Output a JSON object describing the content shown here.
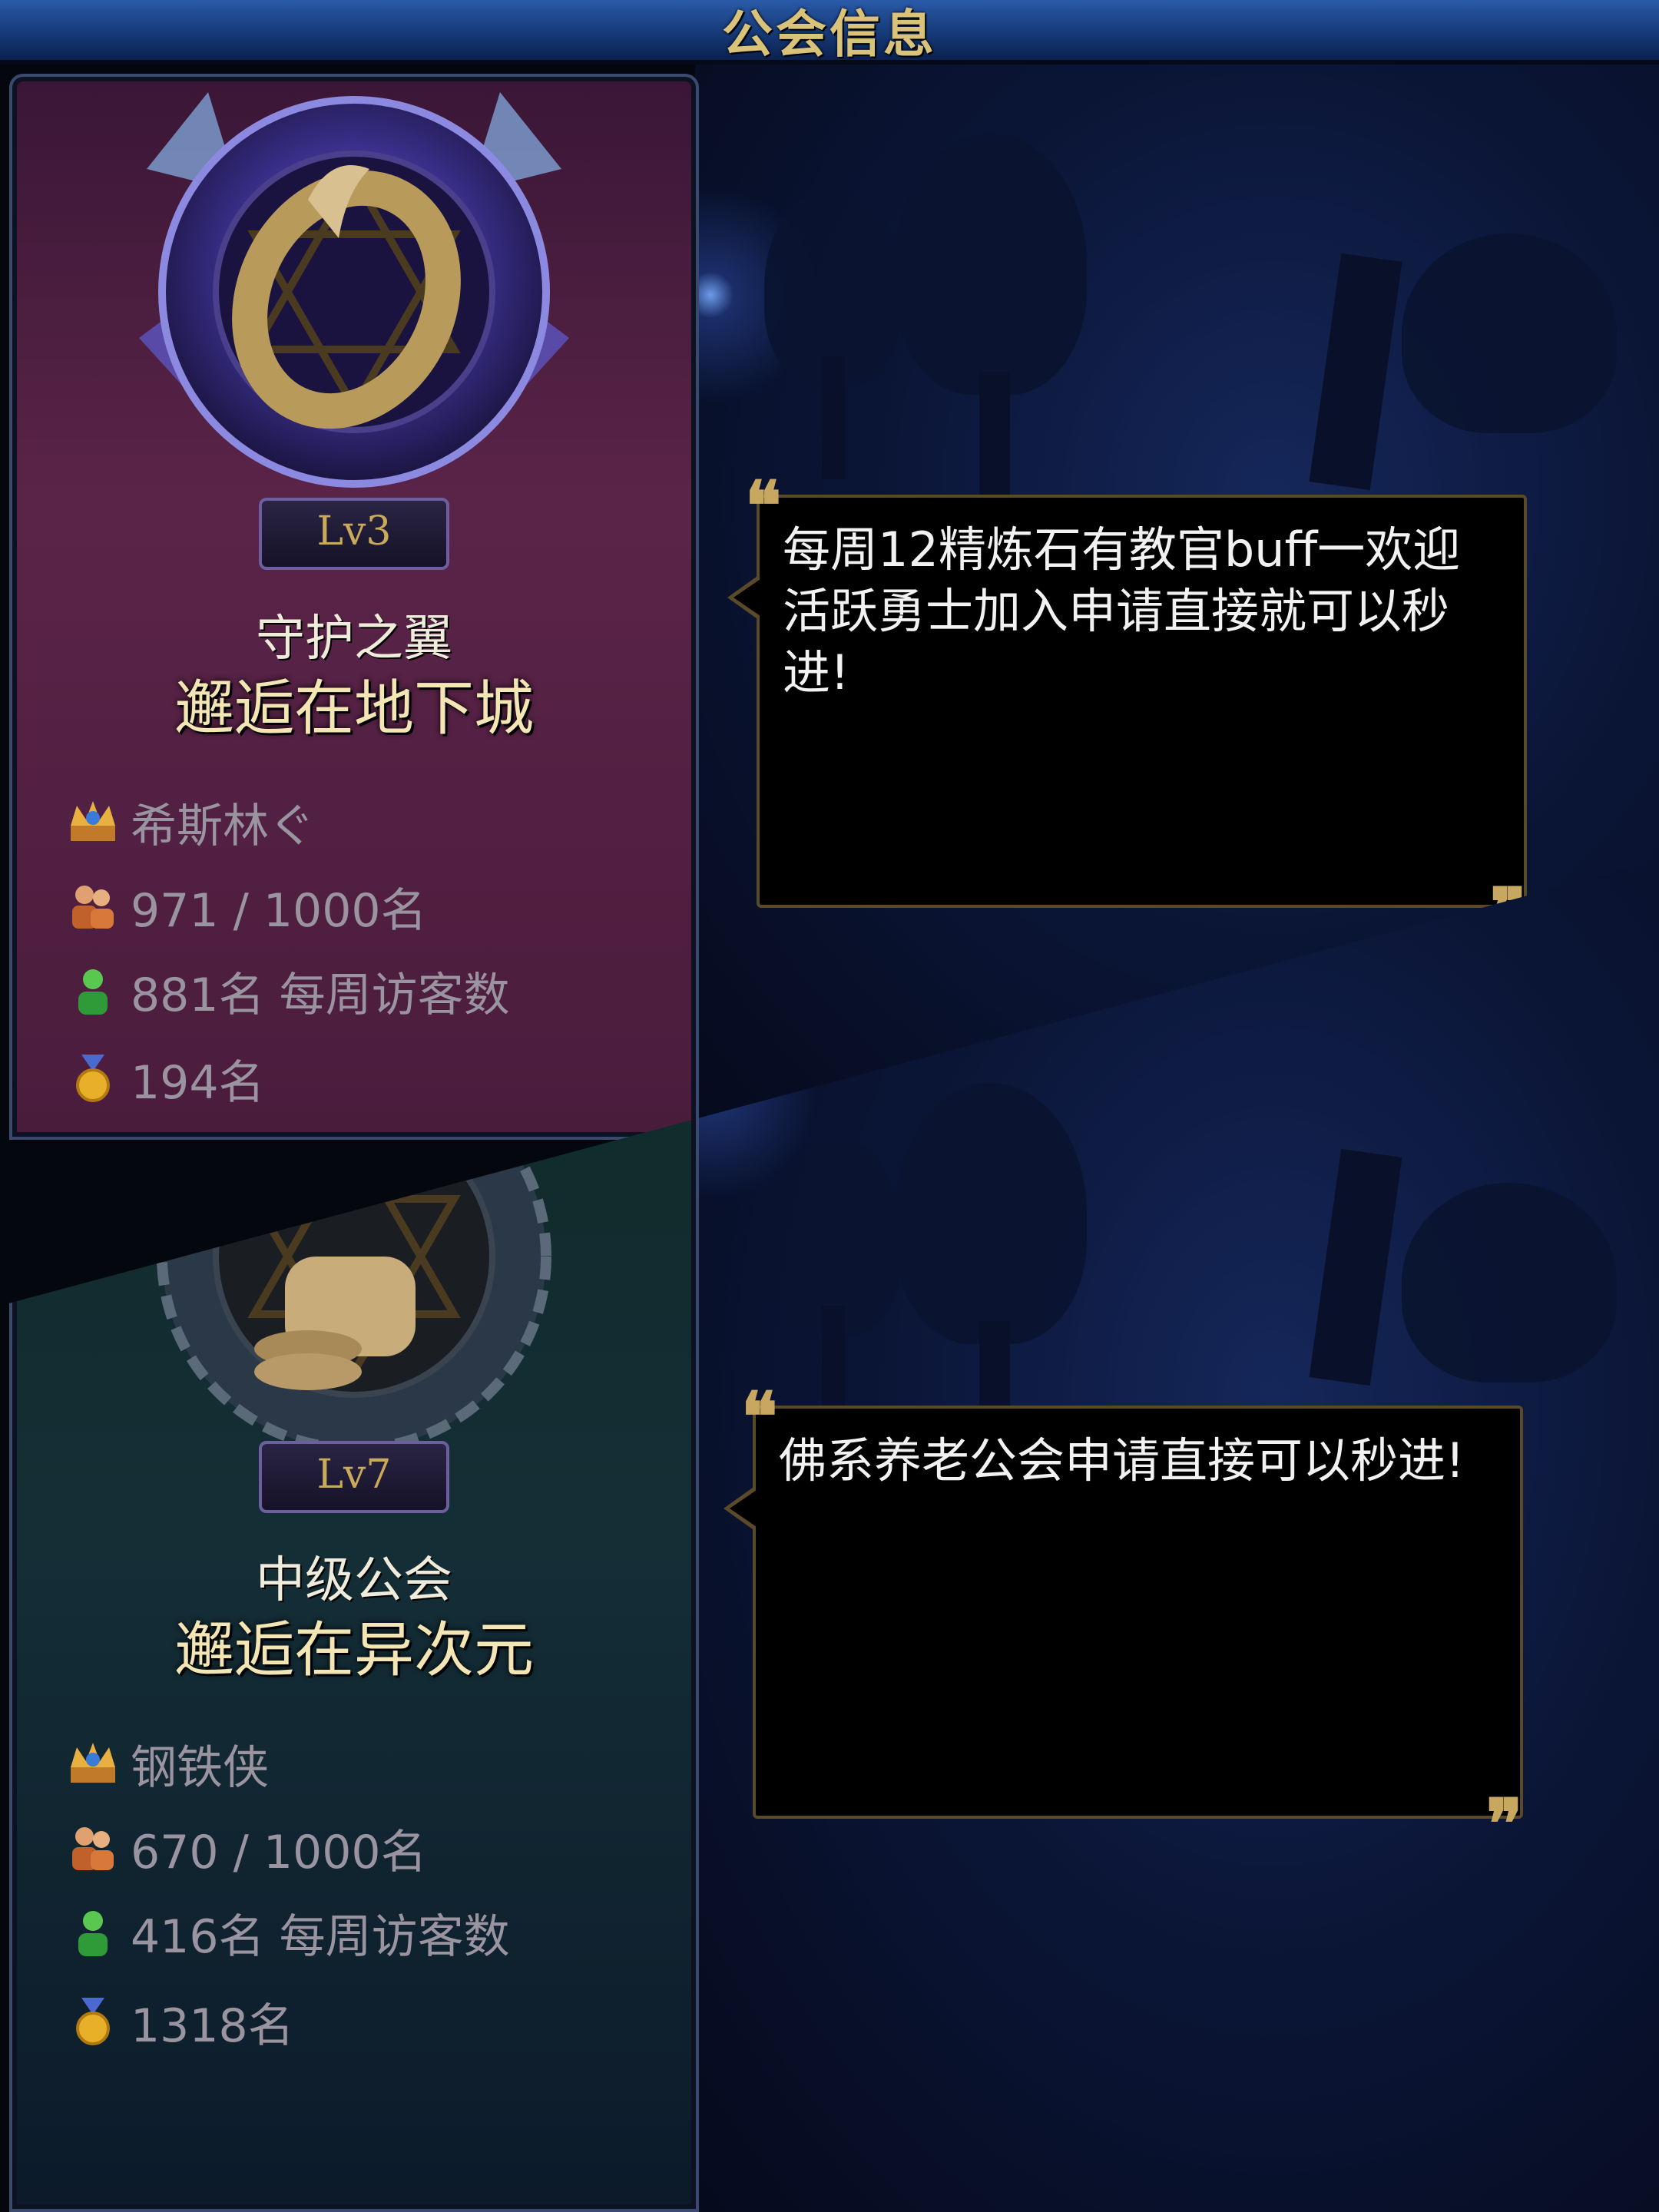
{
  "header": {
    "title": "公会信息"
  },
  "guilds": [
    {
      "level": "Lv3",
      "name": "守护之翼",
      "server": "邂逅在地下城",
      "master": "希斯林ぐ",
      "members": "971 / 1000名",
      "weekly_visitors": "881名 每周访客数",
      "rank": "194名",
      "message": "每周12精炼石有教官buff一欢迎活跃勇士加入申请直接就可以秒进!",
      "theme_color": "#5a2448"
    },
    {
      "level": "Lv7",
      "name": "中级公会",
      "server": "邂逅在异次元",
      "master": "钢铁侠",
      "members": "670 / 1000名",
      "weekly_visitors": "416名 每周访客数",
      "rank": "1318名",
      "message": "佛系养老公会申请直接可以秒进!",
      "theme_color": "#142e36"
    }
  ],
  "icons": {
    "master": "crown-icon",
    "members": "members-icon",
    "visitors": "visitor-icon",
    "rank": "medal-icon"
  },
  "quotes": {
    "open": "❝",
    "close": "❞"
  }
}
